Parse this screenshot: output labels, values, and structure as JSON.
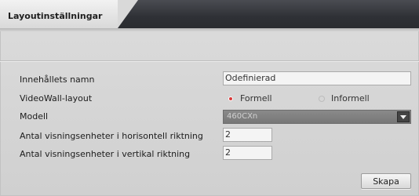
{
  "tab": {
    "label": "Layoutinställningar"
  },
  "form": {
    "name_label": "Innehållets namn",
    "name_value": "Odefinierad",
    "videowall_label": "VideoWall-layout",
    "videowall_options": [
      {
        "label": "Formell",
        "selected": true
      },
      {
        "label": "Informell",
        "selected": false
      }
    ],
    "model_label": "Modell",
    "model_value": "460CXn",
    "horizontal_label": "Antal visningsenheter i horisontell riktning",
    "horizontal_value": "2",
    "vertical_label": "Antal visningsenheter i vertikal riktning",
    "vertical_value": "2"
  },
  "actions": {
    "create_label": "Skapa"
  },
  "colors": {
    "header_dark": "#2f3136",
    "panel_bg": "#d6d6d6",
    "radio_selected": "#d93a3a",
    "select_bg": "#7f7f7f"
  },
  "icons": {
    "dropdown": "chevron-down-icon",
    "radio_on": "radio-selected-icon",
    "radio_off": "radio-unselected-icon"
  }
}
